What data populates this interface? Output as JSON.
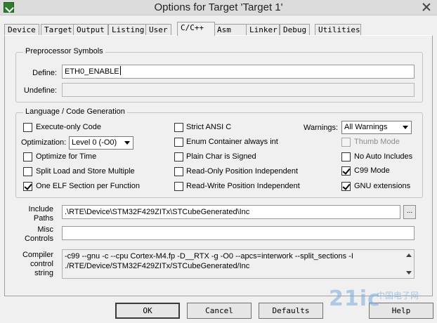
{
  "window": {
    "title": "Options for Target 'Target 1'"
  },
  "tabs": [
    {
      "label": "Device"
    },
    {
      "label": "Target"
    },
    {
      "label": "Output"
    },
    {
      "label": "Listing"
    },
    {
      "label": "User"
    },
    {
      "label": "C/C++"
    },
    {
      "label": "Asm"
    },
    {
      "label": "Linker"
    },
    {
      "label": "Debug"
    },
    {
      "label": "Utilities"
    }
  ],
  "active_tab": "C/C++",
  "preprocessor": {
    "group_title": "Preprocessor Symbols",
    "define_label": "Define:",
    "define_value": "ETH0_ENABLE",
    "undefine_label": "Undefine:",
    "undefine_value": ""
  },
  "language": {
    "group_title": "Language / Code Generation",
    "execute_only": {
      "label": "Execute-only Code",
      "checked": false
    },
    "optimization_label": "Optimization:",
    "optimization_value": "Level 0 (-O0)",
    "optimize_time": {
      "label": "Optimize for Time",
      "checked": false
    },
    "split_load": {
      "label": "Split Load and Store Multiple",
      "checked": false
    },
    "one_elf": {
      "label": "One ELF Section per Function",
      "checked": true
    },
    "strict_ansi": {
      "label": "Strict ANSI C",
      "checked": false
    },
    "enum_container": {
      "label": "Enum Container always int",
      "checked": false
    },
    "plain_char": {
      "label": "Plain Char is Signed",
      "checked": false
    },
    "ro_pos_indep": {
      "label": "Read-Only Position Independent",
      "checked": false
    },
    "rw_pos_indep": {
      "label": "Read-Write Position Independent",
      "checked": false
    },
    "warnings_label": "Warnings:",
    "warnings_value": "All Warnings",
    "thumb_mode": {
      "label": "Thumb Mode",
      "checked": false,
      "disabled": true
    },
    "no_auto_includes": {
      "label": "No Auto Includes",
      "checked": false
    },
    "c99_mode": {
      "label": "C99 Mode",
      "checked": true
    },
    "gnu_extensions": {
      "label": "GNU extensions",
      "checked": true
    }
  },
  "include_paths": {
    "label_line1": "Include",
    "label_line2": "Paths",
    "value": ".\\RTE\\Device\\STM32F429ZITx\\STCubeGenerated\\Inc",
    "browse_label": "..."
  },
  "misc_controls": {
    "label_line1": "Misc",
    "label_line2": "Controls",
    "value": ""
  },
  "compiler_control": {
    "label_line1": "Compiler",
    "label_line2": "control",
    "label_line3": "string",
    "line1": "-c99 --gnu -c --cpu Cortex-M4.fp -D__RTX -g -O0 --apcs=interwork --split_sections -I",
    "line2": "./RTE/Device/STM32F429ZITx/STCubeGenerated/Inc"
  },
  "buttons": {
    "ok": "OK",
    "cancel": "Cancel",
    "defaults": "Defaults",
    "help": "Help"
  },
  "watermark": {
    "text": "21ic",
    "sub": "中国电子网"
  }
}
